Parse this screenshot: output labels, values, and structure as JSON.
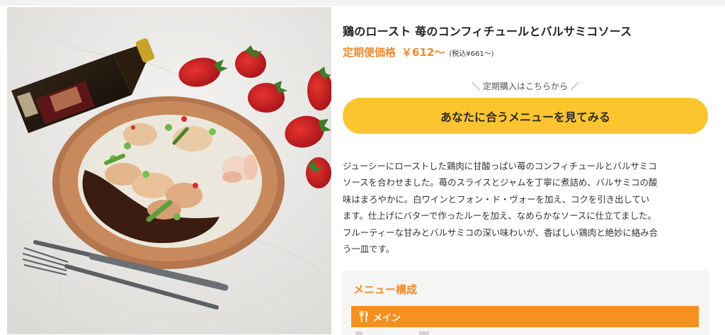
{
  "product": {
    "title": "鶏のロースト 苺のコンフィチュールとバルサミコソース",
    "price_label": "定期便価格",
    "price_value": "￥612〜",
    "tax_note": "(税込¥661〜)",
    "photo_icon": "dish-photo-image"
  },
  "subscribe": {
    "caption": "＼ 定期購入はこちらから ／",
    "cta_label": "あなたに合うメニューを見てみる"
  },
  "description": {
    "lines": [
      "ジューシーにローストした鶏肉に甘酸っぱい苺のコンフィチュールとバルサミコ",
      "ソースを合わせました。苺のスライスとジャムを丁寧に煮詰め、バルサミコの酸",
      "味はまろやかに。白ワインとフォン・ド・ヴォーを加え、コクを引き出してい",
      "ます。仕上げにバターで作ったルーを加え、なめらかなソースに仕立てました。",
      "フルーティーな甘みとバルサミコの深い味わいが、香ばしい鶏肉と絶妙に絡み合",
      "う一皿です。"
    ]
  },
  "menu": {
    "heading": "メニュー構成",
    "main_label": "メイン",
    "main_icon": "fork-knife-icon"
  },
  "colors": {
    "accent_orange": "#ef8a32",
    "bar_orange": "#f6901e",
    "cta_yellow": "#fcc52f",
    "box_bg": "#f5f5f3"
  }
}
